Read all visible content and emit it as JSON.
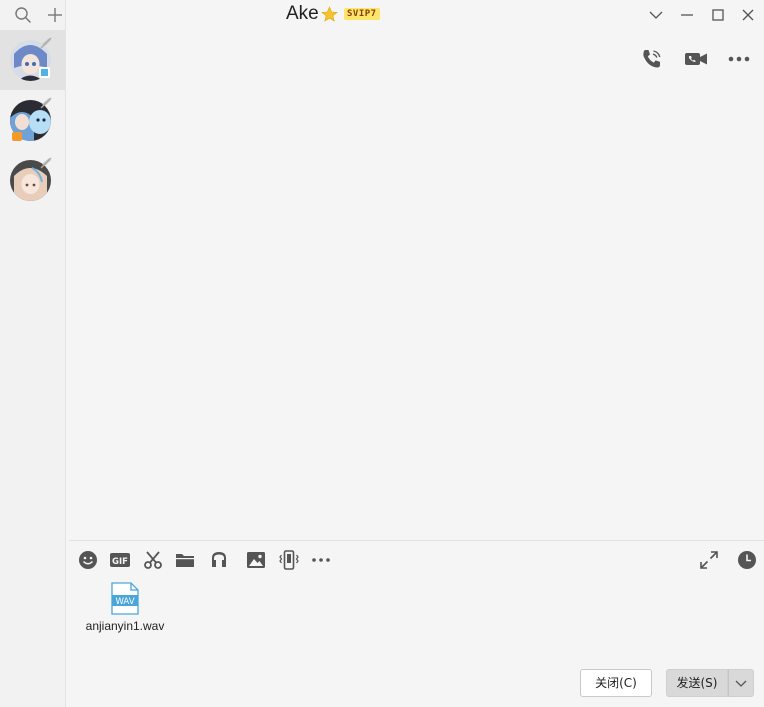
{
  "window": {
    "title": "Ake",
    "vip_badge": "SVIP7"
  },
  "sidebar": {
    "items": [
      {
        "name": "chat-1",
        "active": true
      },
      {
        "name": "chat-2",
        "active": false
      },
      {
        "name": "chat-3",
        "active": false
      }
    ]
  },
  "toolbar": {
    "icons": [
      "emoji-icon",
      "gif-icon",
      "scissors-icon",
      "folder-icon",
      "music-icon",
      "image-icon",
      "shake-icon",
      "more-icon"
    ]
  },
  "attachment": {
    "file_name": "anjianyin1.wav",
    "file_type": "WAV"
  },
  "buttons": {
    "close_label": "关闭(C)",
    "send_label": "发送(S)"
  },
  "colors": {
    "accent": "#4fb3e6",
    "icon": "#555555",
    "vip_bg": "#fde46b",
    "star": "#f5c232"
  }
}
